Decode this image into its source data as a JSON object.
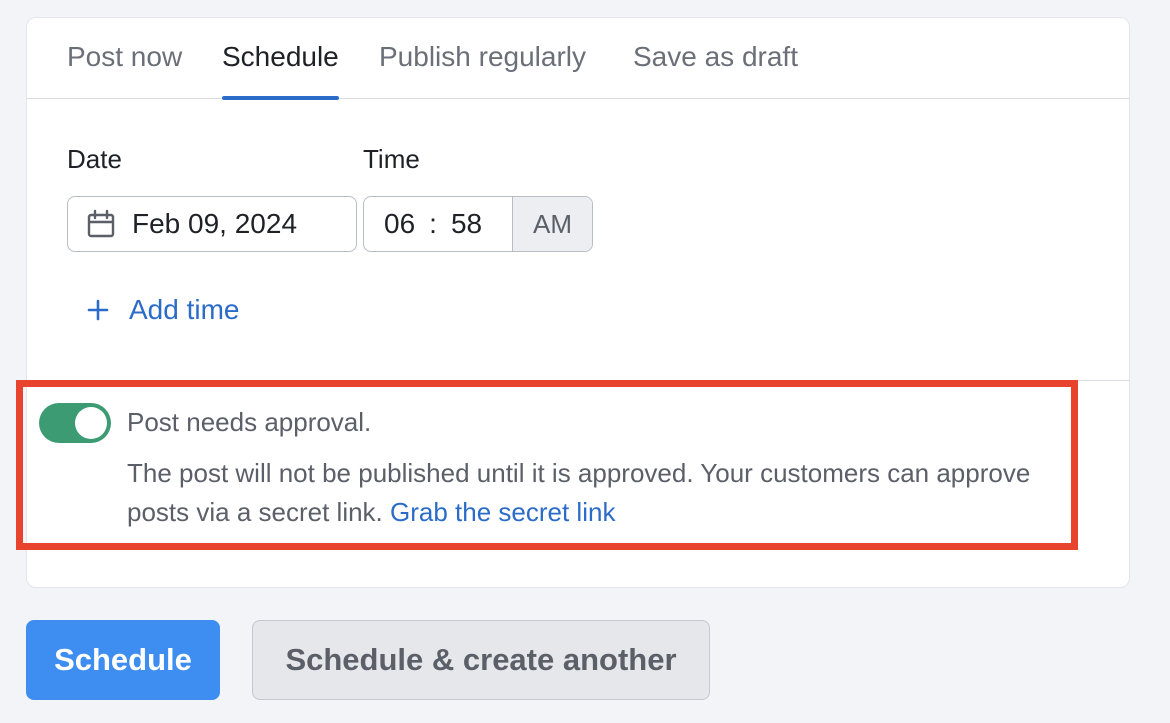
{
  "tabs": [
    {
      "label": "Post now",
      "active": false
    },
    {
      "label": "Schedule",
      "active": true
    },
    {
      "label": "Publish regularly",
      "active": false
    },
    {
      "label": "Save as draft",
      "active": false
    }
  ],
  "schedule": {
    "date_label": "Date",
    "date_value": "Feb 09, 2024",
    "time_label": "Time",
    "time_hour": "06",
    "time_separator": ":",
    "time_minute": "58",
    "time_period": "AM",
    "add_time_label": "Add time"
  },
  "approval": {
    "enabled": true,
    "title": "Post needs approval.",
    "description": "The post will not be published until it is approved. Your customers can approve posts via a secret link.",
    "link_label": "Grab the secret link"
  },
  "actions": {
    "primary_label": "Schedule",
    "secondary_label": "Schedule & create another"
  },
  "colors": {
    "accent": "#2b6cc9",
    "primary_button": "#3d8ef0",
    "toggle_on": "#3d9b73",
    "highlight_border": "#e8432d"
  },
  "icons": {
    "date": "calendar-icon",
    "add": "plus-icon"
  }
}
